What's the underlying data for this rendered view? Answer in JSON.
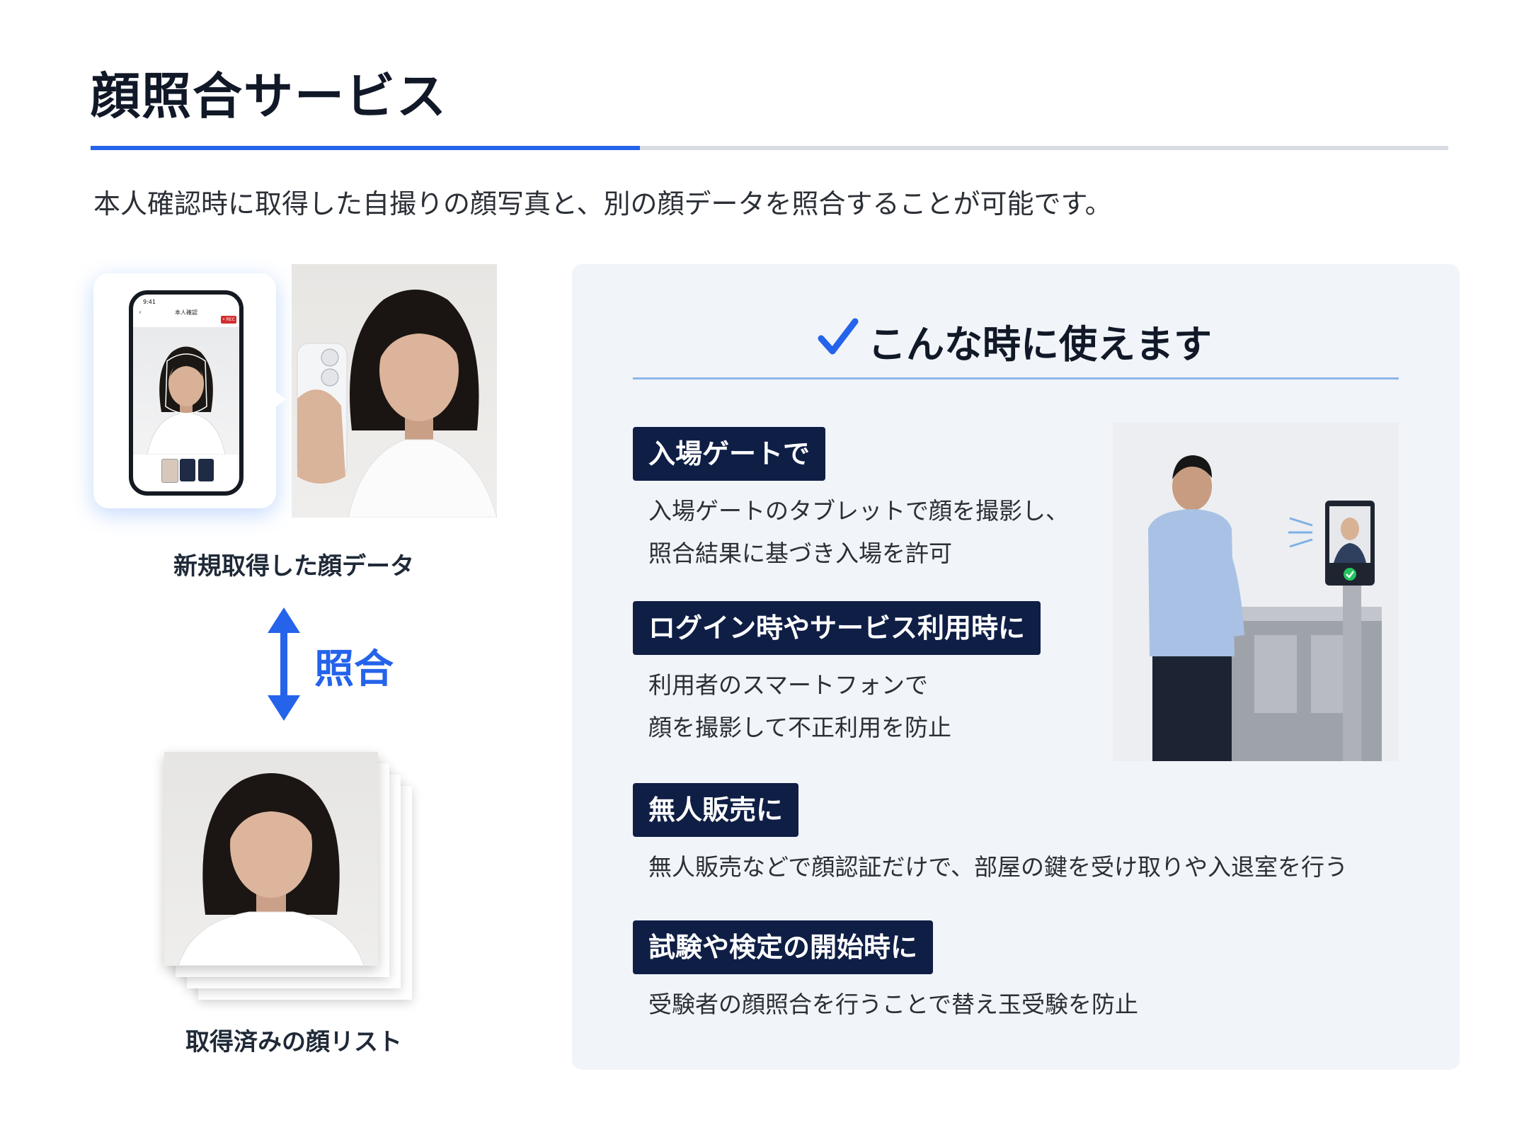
{
  "header": {
    "title": "顔照合サービス",
    "intro": "本人確認時に取得した自撮りの顔写真と、別の顔データを照合することが可能です。"
  },
  "left": {
    "phone": {
      "time": "9:41",
      "screen_title": "本人確認",
      "rec_badge": "• REC"
    },
    "new_face_caption": "新規取得した顔データ",
    "match_label": "照合",
    "face_list_caption": "取得済みの顔リスト"
  },
  "panel": {
    "title": "こんな時に使えます",
    "items": [
      {
        "tag": "入場ゲートで",
        "lines": [
          "入場ゲートのタブレットで顔を撮影し、",
          "照合結果に基づき入場を許可"
        ]
      },
      {
        "tag": "ログイン時やサービス利用時に",
        "lines": [
          "利用者のスマートフォンで",
          "顔を撮影して不正利用を防止"
        ]
      },
      {
        "tag": "無人販売に",
        "lines": [
          "無人販売などで顔認証だけで、部屋の鍵を受け取りや入退室を行う"
        ]
      },
      {
        "tag": "試験や検定の開始時に",
        "lines": [
          "受験者の顔照合を行うことで替え玉受験を防止"
        ]
      }
    ]
  },
  "colors": {
    "accent": "#2563eb",
    "tag_bg": "#0f1e45",
    "panel_bg": "#f1f4f9",
    "rec_red": "#d32f2f",
    "success_green": "#22c55e"
  },
  "icons": [
    "check-icon",
    "double-arrow-icon",
    "back-chevron-icon",
    "verified-check-icon"
  ]
}
